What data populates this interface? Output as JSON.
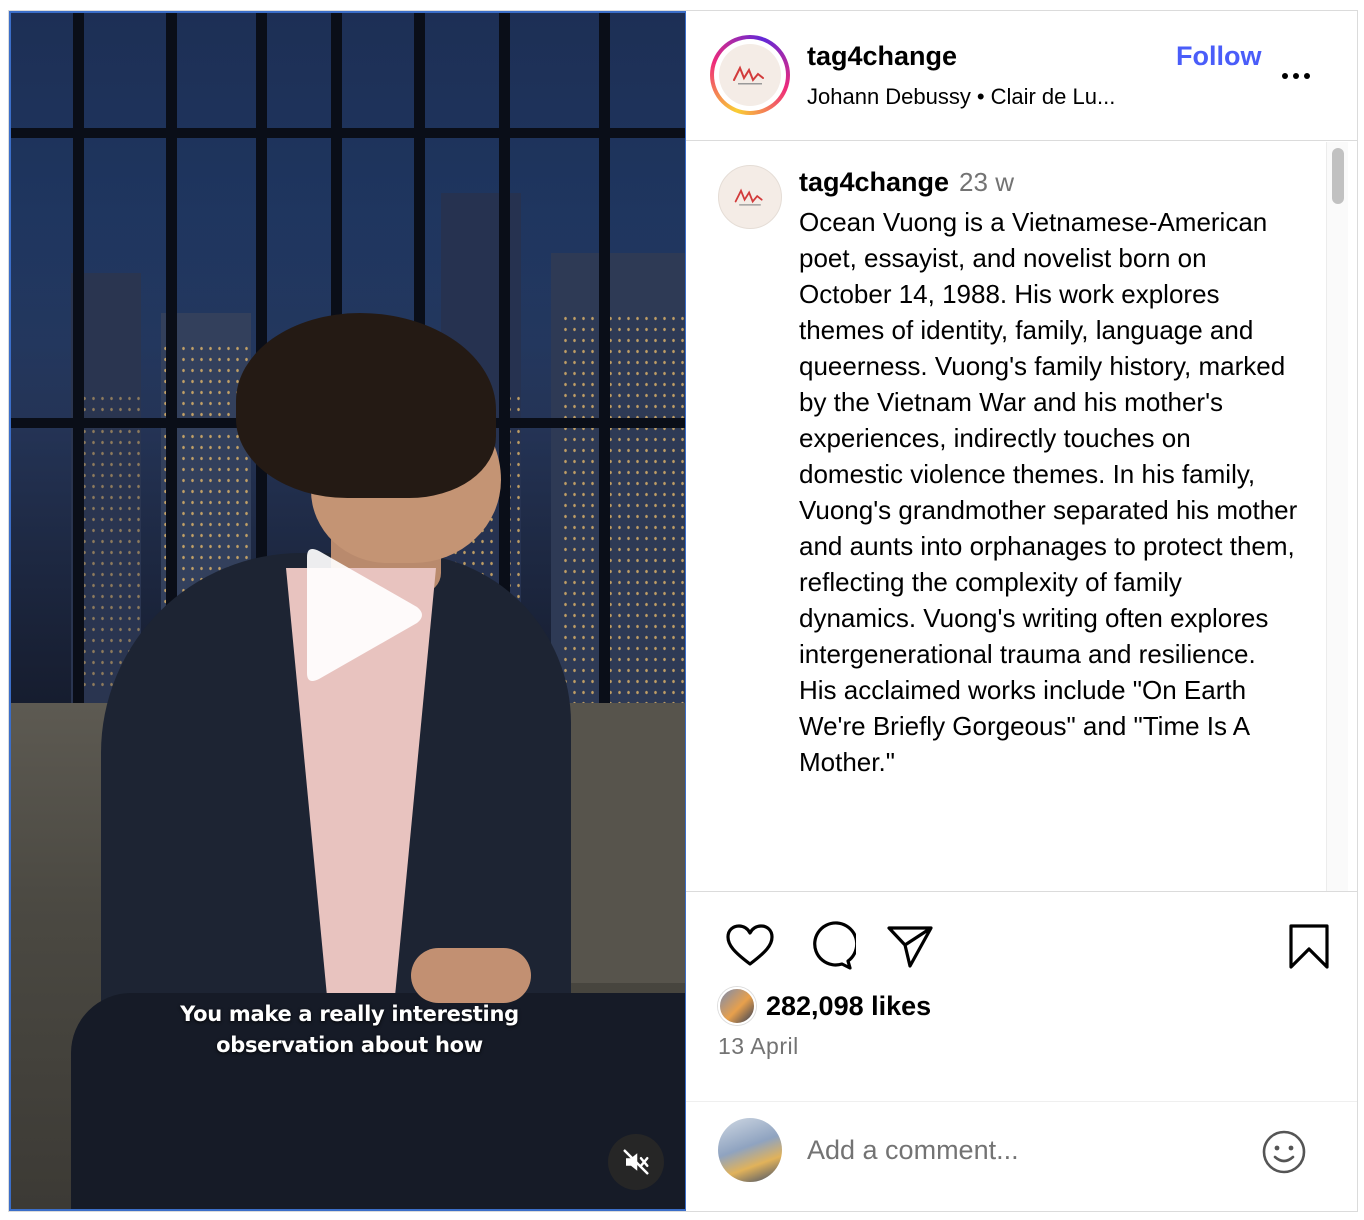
{
  "post": {
    "username": "tag4change",
    "follow_label": "Follow",
    "audio_artist": "Johann Debussy",
    "audio_separator": "•",
    "audio_track": "Clair de Lu...",
    "more_options": "more-options-icon"
  },
  "video": {
    "subtitle_line1": "You make a really interesting",
    "subtitle_line2": "observation about how",
    "play_icon": "play-icon",
    "mute_icon": "muted-speaker-icon"
  },
  "caption": {
    "username": "tag4change",
    "time": "23 w",
    "text": "Ocean Vuong is a Vietnamese-American poet, essayist, and novelist born on October 14, 1988. His work explores themes of identity, family, language and queerness. Vuong's family history, marked by the Vietnam War and his mother's experiences, indirectly touches on domestic violence themes. In his family, Vuong's grandmother separated his mother and aunts into orphanages to protect them, reflecting the complexity of family dynamics. Vuong's writing often explores intergenerational trauma and resilience. His acclaimed works include \"On Earth We're Briefly Gorgeous\" and \"Time Is A Mother.\""
  },
  "stats": {
    "likes": "282,098 likes",
    "date": "13 April"
  },
  "comment": {
    "placeholder": "Add a comment..."
  },
  "colors": {
    "follow": "#4a5df9",
    "secondary_text": "#737373",
    "border": "#dbdbdb"
  }
}
